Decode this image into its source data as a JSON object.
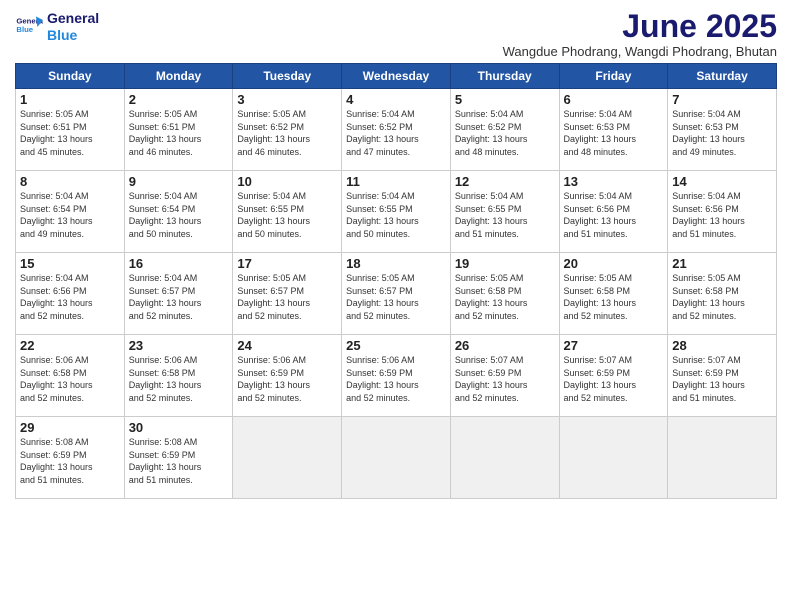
{
  "logo": {
    "line1": "General",
    "line2": "Blue"
  },
  "title": "June 2025",
  "subtitle": "Wangdue Phodrang, Wangdi Phodrang, Bhutan",
  "headers": [
    "Sunday",
    "Monday",
    "Tuesday",
    "Wednesday",
    "Thursday",
    "Friday",
    "Saturday"
  ],
  "weeks": [
    [
      {
        "day": "1",
        "lines": [
          "Sunrise: 5:05 AM",
          "Sunset: 6:51 PM",
          "Daylight: 13 hours",
          "and 45 minutes."
        ]
      },
      {
        "day": "2",
        "lines": [
          "Sunrise: 5:05 AM",
          "Sunset: 6:51 PM",
          "Daylight: 13 hours",
          "and 46 minutes."
        ]
      },
      {
        "day": "3",
        "lines": [
          "Sunrise: 5:05 AM",
          "Sunset: 6:52 PM",
          "Daylight: 13 hours",
          "and 46 minutes."
        ]
      },
      {
        "day": "4",
        "lines": [
          "Sunrise: 5:04 AM",
          "Sunset: 6:52 PM",
          "Daylight: 13 hours",
          "and 47 minutes."
        ]
      },
      {
        "day": "5",
        "lines": [
          "Sunrise: 5:04 AM",
          "Sunset: 6:52 PM",
          "Daylight: 13 hours",
          "and 48 minutes."
        ]
      },
      {
        "day": "6",
        "lines": [
          "Sunrise: 5:04 AM",
          "Sunset: 6:53 PM",
          "Daylight: 13 hours",
          "and 48 minutes."
        ]
      },
      {
        "day": "7",
        "lines": [
          "Sunrise: 5:04 AM",
          "Sunset: 6:53 PM",
          "Daylight: 13 hours",
          "and 49 minutes."
        ]
      }
    ],
    [
      {
        "day": "8",
        "lines": [
          "Sunrise: 5:04 AM",
          "Sunset: 6:54 PM",
          "Daylight: 13 hours",
          "and 49 minutes."
        ]
      },
      {
        "day": "9",
        "lines": [
          "Sunrise: 5:04 AM",
          "Sunset: 6:54 PM",
          "Daylight: 13 hours",
          "and 50 minutes."
        ]
      },
      {
        "day": "10",
        "lines": [
          "Sunrise: 5:04 AM",
          "Sunset: 6:55 PM",
          "Daylight: 13 hours",
          "and 50 minutes."
        ]
      },
      {
        "day": "11",
        "lines": [
          "Sunrise: 5:04 AM",
          "Sunset: 6:55 PM",
          "Daylight: 13 hours",
          "and 50 minutes."
        ]
      },
      {
        "day": "12",
        "lines": [
          "Sunrise: 5:04 AM",
          "Sunset: 6:55 PM",
          "Daylight: 13 hours",
          "and 51 minutes."
        ]
      },
      {
        "day": "13",
        "lines": [
          "Sunrise: 5:04 AM",
          "Sunset: 6:56 PM",
          "Daylight: 13 hours",
          "and 51 minutes."
        ]
      },
      {
        "day": "14",
        "lines": [
          "Sunrise: 5:04 AM",
          "Sunset: 6:56 PM",
          "Daylight: 13 hours",
          "and 51 minutes."
        ]
      }
    ],
    [
      {
        "day": "15",
        "lines": [
          "Sunrise: 5:04 AM",
          "Sunset: 6:56 PM",
          "Daylight: 13 hours",
          "and 52 minutes."
        ]
      },
      {
        "day": "16",
        "lines": [
          "Sunrise: 5:04 AM",
          "Sunset: 6:57 PM",
          "Daylight: 13 hours",
          "and 52 minutes."
        ]
      },
      {
        "day": "17",
        "lines": [
          "Sunrise: 5:05 AM",
          "Sunset: 6:57 PM",
          "Daylight: 13 hours",
          "and 52 minutes."
        ]
      },
      {
        "day": "18",
        "lines": [
          "Sunrise: 5:05 AM",
          "Sunset: 6:57 PM",
          "Daylight: 13 hours",
          "and 52 minutes."
        ]
      },
      {
        "day": "19",
        "lines": [
          "Sunrise: 5:05 AM",
          "Sunset: 6:58 PM",
          "Daylight: 13 hours",
          "and 52 minutes."
        ]
      },
      {
        "day": "20",
        "lines": [
          "Sunrise: 5:05 AM",
          "Sunset: 6:58 PM",
          "Daylight: 13 hours",
          "and 52 minutes."
        ]
      },
      {
        "day": "21",
        "lines": [
          "Sunrise: 5:05 AM",
          "Sunset: 6:58 PM",
          "Daylight: 13 hours",
          "and 52 minutes."
        ]
      }
    ],
    [
      {
        "day": "22",
        "lines": [
          "Sunrise: 5:06 AM",
          "Sunset: 6:58 PM",
          "Daylight: 13 hours",
          "and 52 minutes."
        ]
      },
      {
        "day": "23",
        "lines": [
          "Sunrise: 5:06 AM",
          "Sunset: 6:58 PM",
          "Daylight: 13 hours",
          "and 52 minutes."
        ]
      },
      {
        "day": "24",
        "lines": [
          "Sunrise: 5:06 AM",
          "Sunset: 6:59 PM",
          "Daylight: 13 hours",
          "and 52 minutes."
        ]
      },
      {
        "day": "25",
        "lines": [
          "Sunrise: 5:06 AM",
          "Sunset: 6:59 PM",
          "Daylight: 13 hours",
          "and 52 minutes."
        ]
      },
      {
        "day": "26",
        "lines": [
          "Sunrise: 5:07 AM",
          "Sunset: 6:59 PM",
          "Daylight: 13 hours",
          "and 52 minutes."
        ]
      },
      {
        "day": "27",
        "lines": [
          "Sunrise: 5:07 AM",
          "Sunset: 6:59 PM",
          "Daylight: 13 hours",
          "and 52 minutes."
        ]
      },
      {
        "day": "28",
        "lines": [
          "Sunrise: 5:07 AM",
          "Sunset: 6:59 PM",
          "Daylight: 13 hours",
          "and 51 minutes."
        ]
      }
    ],
    [
      {
        "day": "29",
        "lines": [
          "Sunrise: 5:08 AM",
          "Sunset: 6:59 PM",
          "Daylight: 13 hours",
          "and 51 minutes."
        ]
      },
      {
        "day": "30",
        "lines": [
          "Sunrise: 5:08 AM",
          "Sunset: 6:59 PM",
          "Daylight: 13 hours",
          "and 51 minutes."
        ]
      },
      {
        "day": "",
        "lines": []
      },
      {
        "day": "",
        "lines": []
      },
      {
        "day": "",
        "lines": []
      },
      {
        "day": "",
        "lines": []
      },
      {
        "day": "",
        "lines": []
      }
    ]
  ]
}
